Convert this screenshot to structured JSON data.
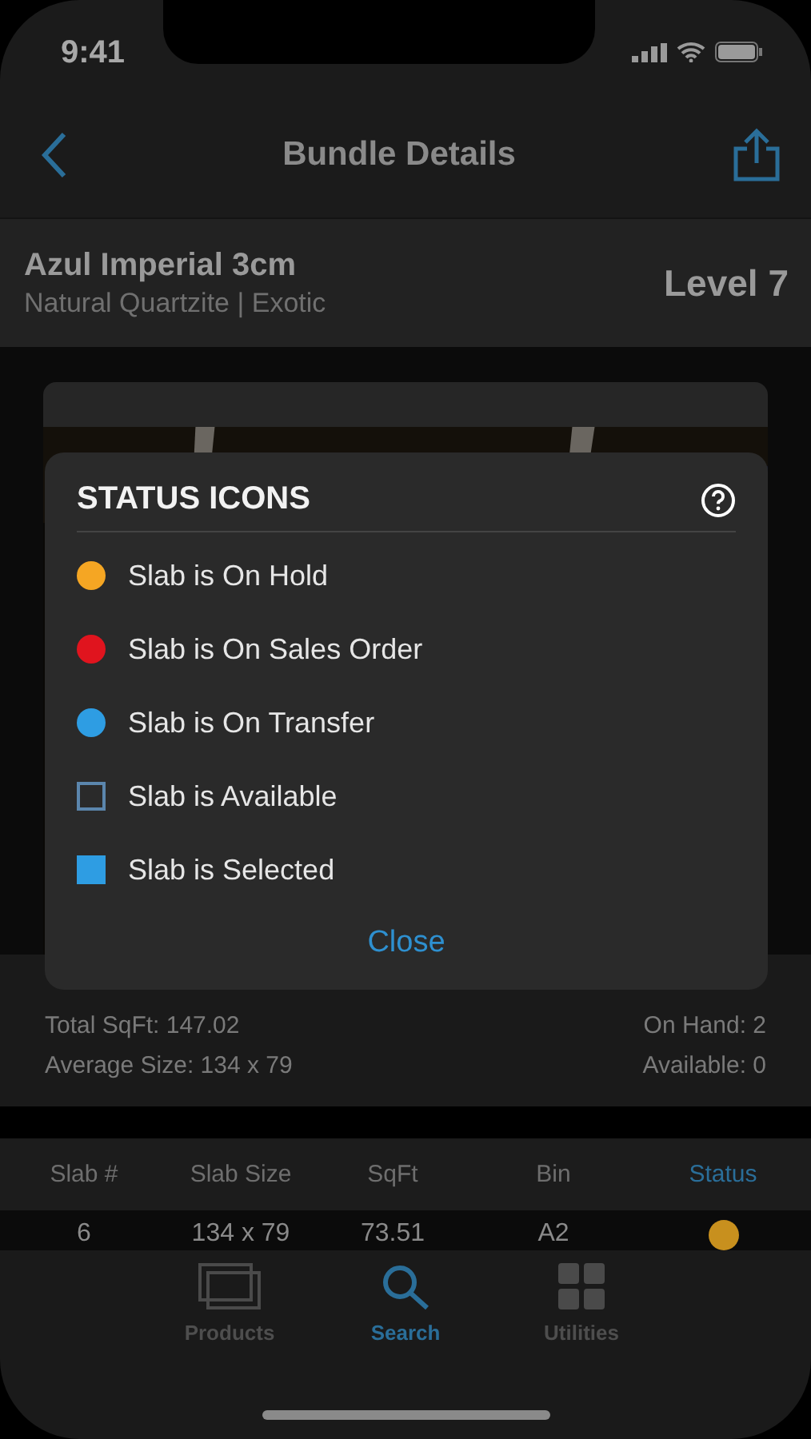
{
  "status_bar": {
    "time": "9:41"
  },
  "nav": {
    "title": "Bundle Details"
  },
  "product": {
    "name": "Azul Imperial 3cm",
    "subtitle": "Natural Quartzite | Exotic",
    "level": "Level 7"
  },
  "summary": {
    "left": [
      "Total SqFt: 147.02",
      "Average Size: 134 x 79"
    ],
    "right": [
      "On Hand: 2",
      "Available: 0"
    ]
  },
  "table": {
    "columns": [
      {
        "label": "Slab #",
        "selected": false
      },
      {
        "label": "Slab Size",
        "selected": false
      },
      {
        "label": "SqFt",
        "selected": false
      },
      {
        "label": "Bin",
        "selected": false
      },
      {
        "label": "Status",
        "selected": true
      }
    ],
    "rows": [
      {
        "cells": [
          "6",
          "134 x 79",
          "73.51",
          "A2"
        ],
        "color": "#c8901e"
      }
    ]
  },
  "tab_bar": [
    {
      "label": "Products",
      "kind": "slabs",
      "selected": false
    },
    {
      "label": "Search",
      "kind": "search",
      "selected": true
    },
    {
      "label": "Utilities",
      "kind": "grid",
      "selected": false
    }
  ],
  "dialog": {
    "title": "STATUS ICONS",
    "items": [
      {
        "kind": "dot",
        "color": "#f5a623",
        "label": "Slab is On Hold"
      },
      {
        "kind": "dot",
        "color": "#e0141e",
        "label": "Slab is On Sales Order"
      },
      {
        "kind": "dot",
        "color": "#2e9de3",
        "label": "Slab is On Transfer"
      },
      {
        "kind": "outline",
        "color": "#5b86ad",
        "label": "Slab is Available"
      },
      {
        "kind": "filled",
        "color": "#2e9de3",
        "label": "Slab is Selected"
      }
    ],
    "close": "Close"
  }
}
